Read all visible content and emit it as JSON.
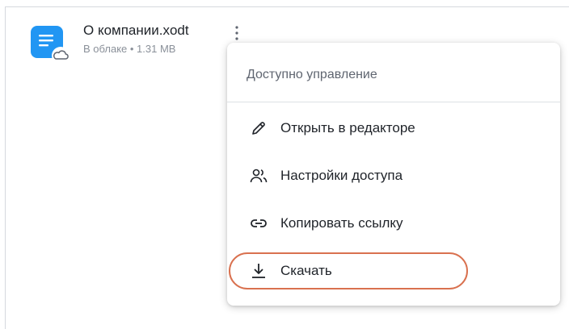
{
  "file": {
    "name": "О компании.xodt",
    "meta": "В облаке • 1.31 MB",
    "icon": "document-cloud-icon",
    "icon_color": "#2196f3"
  },
  "menu": {
    "header": "Доступно управление",
    "items": [
      {
        "label": "Открыть в редакторе",
        "icon": "pencil-icon"
      },
      {
        "label": "Настройки доступа",
        "icon": "people-icon"
      },
      {
        "label": "Копировать ссылку",
        "icon": "link-icon"
      },
      {
        "label": "Скачать",
        "icon": "download-icon"
      }
    ]
  },
  "colors": {
    "highlight": "#d9714f",
    "text": "#1f2329",
    "muted": "#8a9099"
  }
}
